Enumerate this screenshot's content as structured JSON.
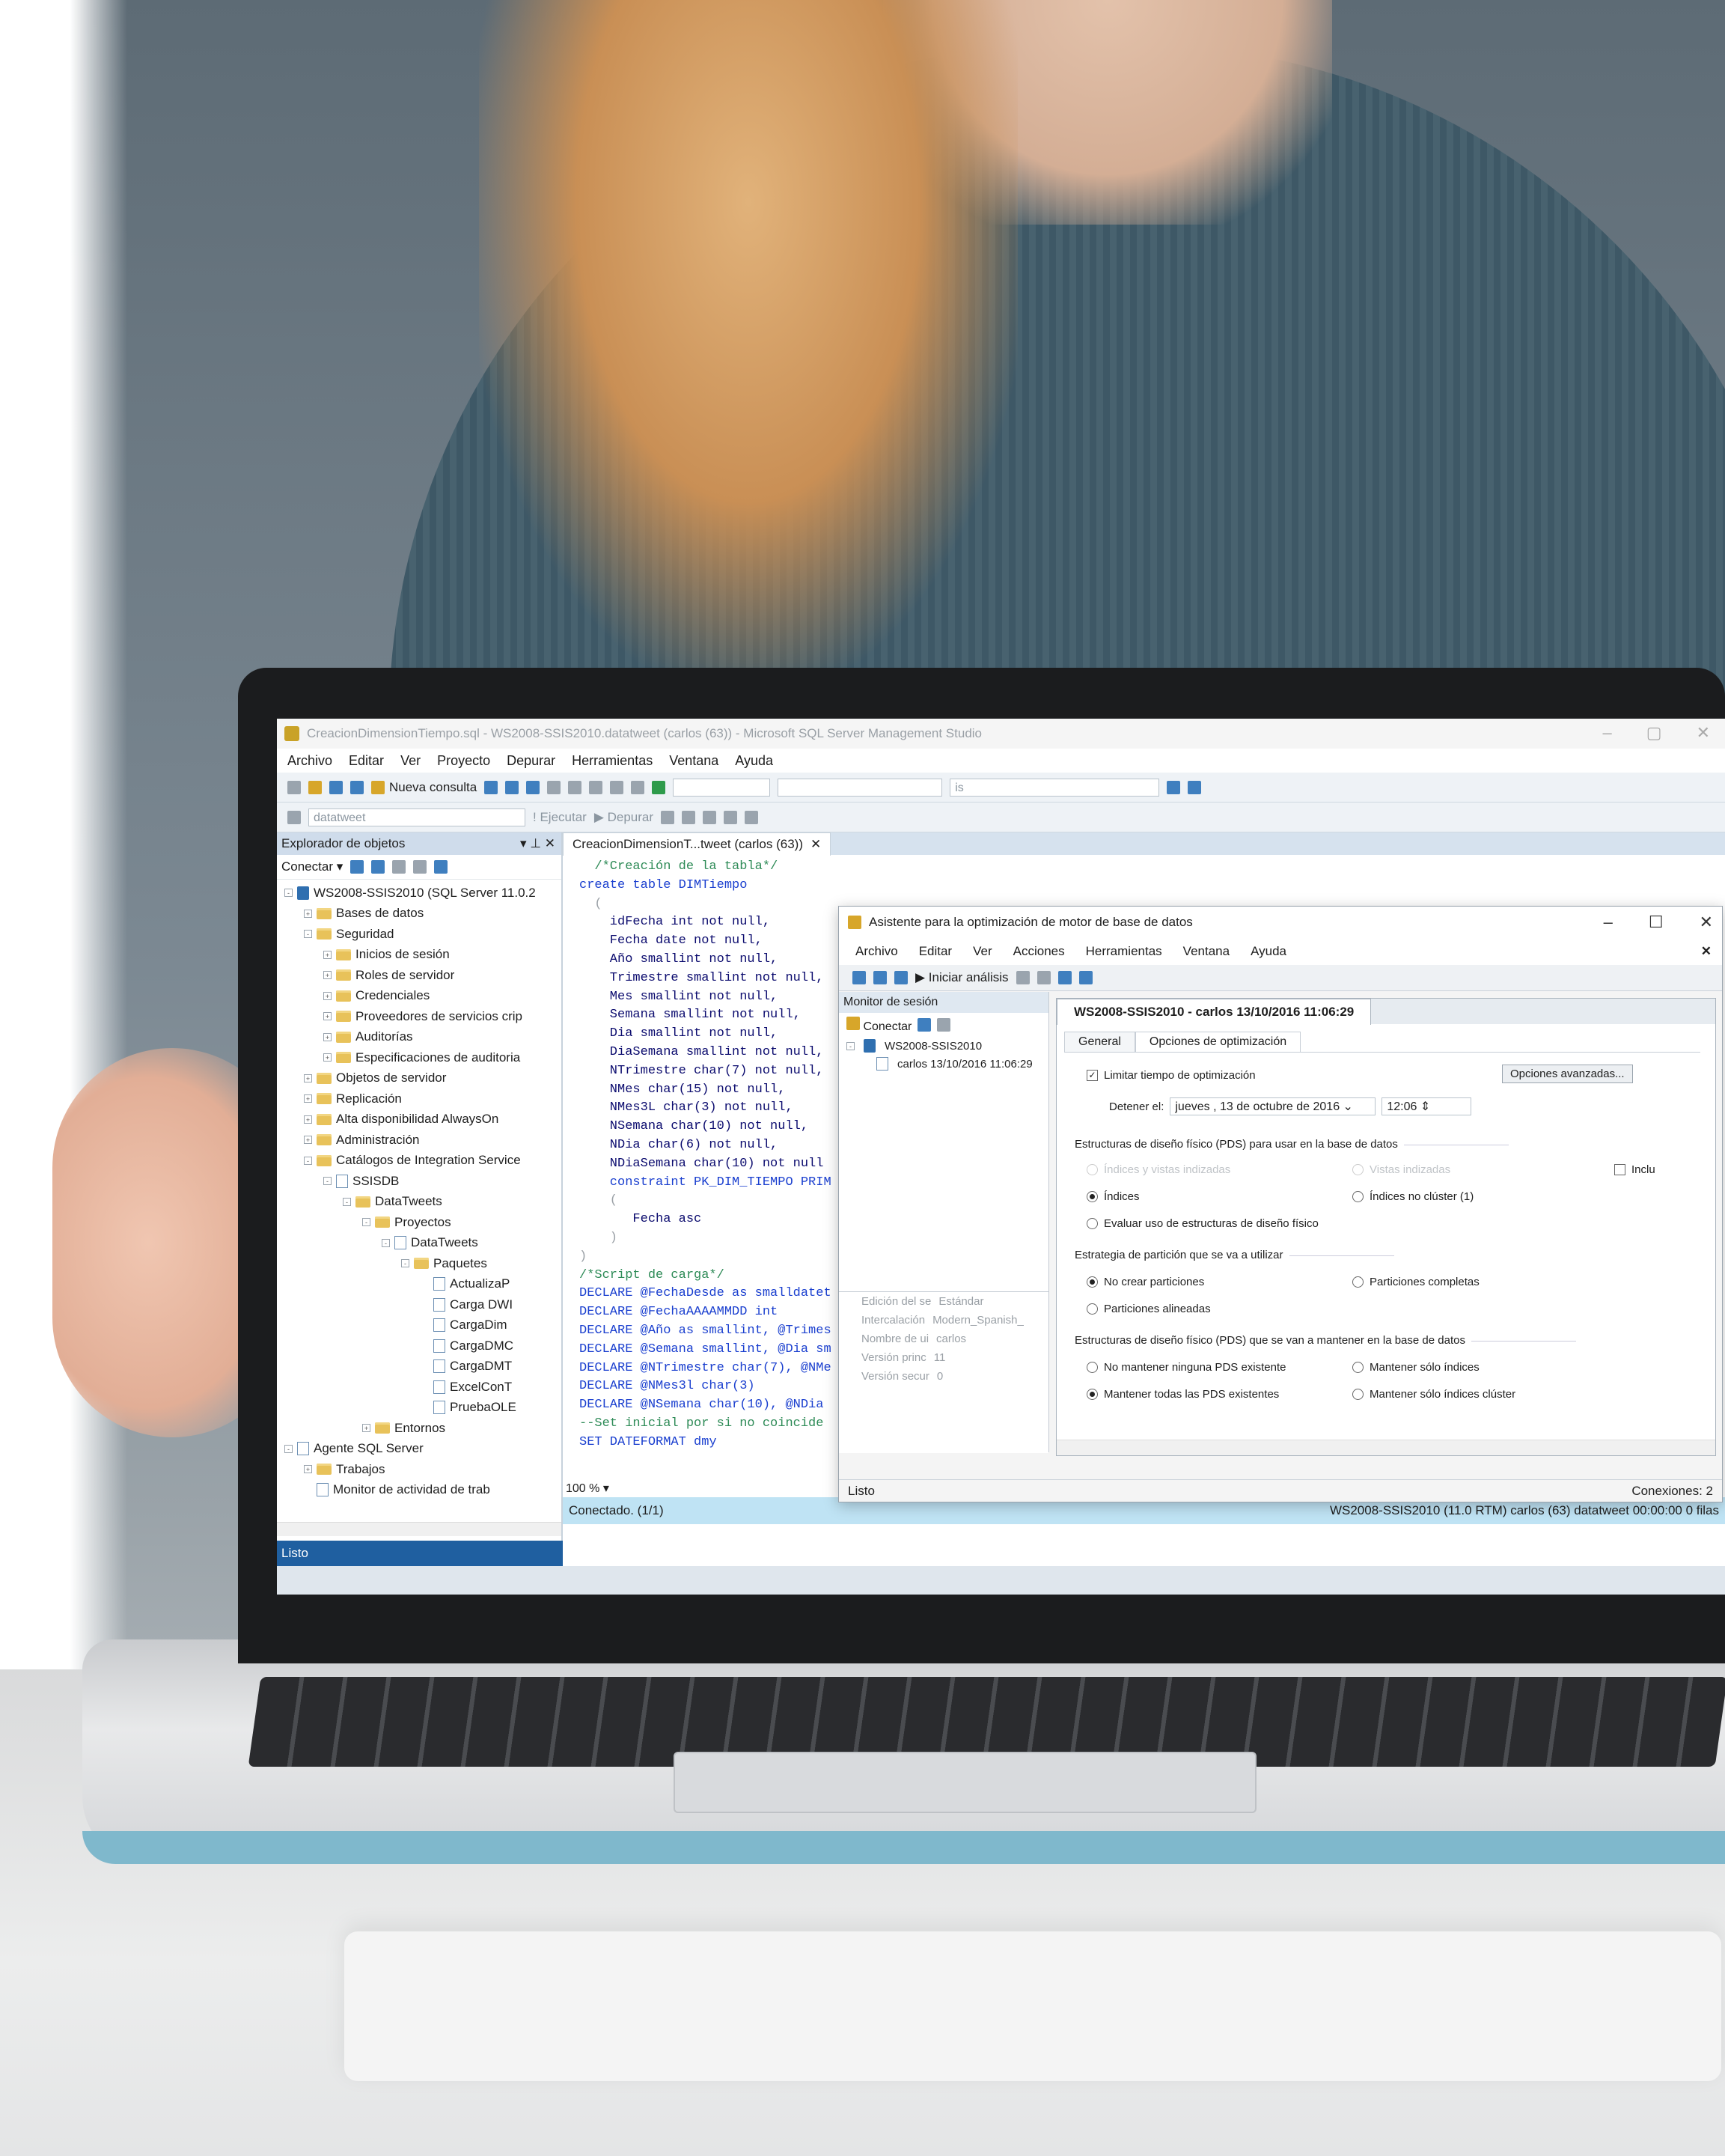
{
  "ssms": {
    "window_title": "CreacionDimensionTiempo.sql - WS2008-SSIS2010.datatweet (carlos (63)) - Microsoft SQL Server Management Studio",
    "menu": [
      "Archivo",
      "Editar",
      "Ver",
      "Proyecto",
      "Depurar",
      "Herramientas",
      "Ventana",
      "Ayuda"
    ],
    "toolbar": {
      "new_query": "Nueva consulta",
      "search_value": "is",
      "database": "datatweet",
      "execute": "Ejecutar",
      "debug": "Depurar"
    },
    "object_explorer": {
      "title": "Explorador de objetos",
      "connect": "Conectar",
      "nodes": [
        {
          "label": "WS2008-SSIS2010 (SQL Server 11.0.2",
          "level": 0,
          "kind": "server",
          "expand": "-"
        },
        {
          "label": "Bases de datos",
          "level": 1,
          "kind": "folder",
          "expand": "+"
        },
        {
          "label": "Seguridad",
          "level": 1,
          "kind": "folder",
          "expand": "-"
        },
        {
          "label": "Inicios de sesión",
          "level": 2,
          "kind": "folder",
          "expand": "+"
        },
        {
          "label": "Roles de servidor",
          "level": 2,
          "kind": "folder",
          "expand": "+"
        },
        {
          "label": "Credenciales",
          "level": 2,
          "kind": "folder",
          "expand": "+"
        },
        {
          "label": "Proveedores de servicios crip",
          "level": 2,
          "kind": "folder",
          "expand": "+"
        },
        {
          "label": "Auditorías",
          "level": 2,
          "kind": "folder",
          "expand": "+"
        },
        {
          "label": "Especificaciones de auditoria",
          "level": 2,
          "kind": "folder",
          "expand": "+"
        },
        {
          "label": "Objetos de servidor",
          "level": 1,
          "kind": "folder",
          "expand": "+"
        },
        {
          "label": "Replicación",
          "level": 1,
          "kind": "folder",
          "expand": "+"
        },
        {
          "label": "Alta disponibilidad AlwaysOn",
          "level": 1,
          "kind": "folder",
          "expand": "+"
        },
        {
          "label": "Administración",
          "level": 1,
          "kind": "folder",
          "expand": "+"
        },
        {
          "label": "Catálogos de Integration Service",
          "level": 1,
          "kind": "folder",
          "expand": "-"
        },
        {
          "label": "SSISDB",
          "level": 2,
          "kind": "pkg",
          "expand": "-"
        },
        {
          "label": "DataTweets",
          "level": 3,
          "kind": "folder",
          "expand": "-"
        },
        {
          "label": "Proyectos",
          "level": 4,
          "kind": "folder",
          "expand": "-"
        },
        {
          "label": "DataTweets",
          "level": 5,
          "kind": "pkg",
          "expand": "-"
        },
        {
          "label": "Paquetes",
          "level": 6,
          "kind": "folder",
          "expand": "-"
        },
        {
          "label": "ActualizaP",
          "level": 7,
          "kind": "pkg",
          "expand": ""
        },
        {
          "label": "Carga DWI",
          "level": 7,
          "kind": "pkg",
          "expand": ""
        },
        {
          "label": "CargaDim",
          "level": 7,
          "kind": "pkg",
          "expand": ""
        },
        {
          "label": "CargaDMC",
          "level": 7,
          "kind": "pkg",
          "expand": ""
        },
        {
          "label": "CargaDMT",
          "level": 7,
          "kind": "pkg",
          "expand": ""
        },
        {
          "label": "ExcelConT",
          "level": 7,
          "kind": "pkg",
          "expand": ""
        },
        {
          "label": "PruebaOLE",
          "level": 7,
          "kind": "pkg",
          "expand": ""
        },
        {
          "label": "Entornos",
          "level": 4,
          "kind": "folder",
          "expand": "+"
        },
        {
          "label": "Agente SQL Server",
          "level": 0,
          "kind": "pkg",
          "expand": "-"
        },
        {
          "label": "Trabajos",
          "level": 1,
          "kind": "folder",
          "expand": "+"
        },
        {
          "label": "Monitor de actividad de trab",
          "level": 1,
          "kind": "pkg",
          "expand": ""
        }
      ],
      "status": "Listo"
    },
    "editor": {
      "tab_label": "CreacionDimensionT...tweet (carlos (63))",
      "zoom": "100 %",
      "code_lines": [
        [
          "cm",
          "  /*Creación de la tabla*/"
        ],
        [
          "kw",
          "create table DIMTiempo"
        ],
        [
          "gr",
          "  ("
        ],
        [
          "id",
          "    idFecha int not null,"
        ],
        [
          "id",
          "    Fecha date not null,"
        ],
        [
          "id",
          "    Año smallint not null,"
        ],
        [
          "id",
          "    Trimestre smallint not null,"
        ],
        [
          "id",
          "    Mes smallint not null,"
        ],
        [
          "id",
          "    Semana smallint not null,"
        ],
        [
          "id",
          "    Dia smallint not null,"
        ],
        [
          "id",
          "    DiaSemana smallint not null,"
        ],
        [
          "id",
          "    NTrimestre char(7) not null,"
        ],
        [
          "id",
          "    NMes char(15) not null,"
        ],
        [
          "id",
          "    NMes3L char(3) not null,"
        ],
        [
          "id",
          "    NSemana char(10) not null,"
        ],
        [
          "id",
          "    NDia char(6) not null,"
        ],
        [
          "id",
          "    NDiaSemana char(10) not null"
        ],
        [
          "kw",
          "    constraint PK_DIM_TIEMPO PRIM"
        ],
        [
          "gr",
          "    ("
        ],
        [
          "id",
          "       Fecha asc"
        ],
        [
          "gr",
          "    )"
        ],
        [
          "gr",
          ")"
        ],
        [
          "gr",
          ""
        ],
        [
          "cm",
          "/*Script de carga*/"
        ],
        [
          "kw",
          "DECLARE @FechaDesde as smalldatet"
        ],
        [
          "kw",
          "DECLARE @FechaAAAAMMDD int"
        ],
        [
          "kw",
          "DECLARE @Año as smallint, @Trimes"
        ],
        [
          "kw",
          "DECLARE @Semana smallint, @Dia sm"
        ],
        [
          "kw",
          "DECLARE @NTrimestre char(7), @NMe"
        ],
        [
          "kw",
          "DECLARE @NMes3l char(3)"
        ],
        [
          "kw",
          "DECLARE @NSemana char(10), @NDia"
        ],
        [
          "cm",
          "--Set inicial por si no coincide"
        ],
        [
          "kw",
          "SET DATEFORMAT dmy"
        ]
      ],
      "status_left": "Conectado. (1/1)",
      "status_right": "WS2008-SSIS2010 (11.0 RTM)   carlos (63)   datatweet   00:00:00   0 filas"
    }
  },
  "tuning_advisor": {
    "title": "Asistente para la optimización de motor de base de datos",
    "menu": [
      "Archivo",
      "Editar",
      "Ver",
      "Acciones",
      "Herramientas",
      "Ventana",
      "Ayuda"
    ],
    "start_analysis": "Iniciar análisis",
    "session_monitor": "Monitor de sesión",
    "connect": "Conectar",
    "server": "WS2008-SSIS2010",
    "session_item": "carlos 13/10/2016 11:06:29",
    "properties": [
      [
        "Edición del se",
        "Estándar"
      ],
      [
        "Intercalación",
        "Modern_Spanish_"
      ],
      [
        "Nombre de ui",
        "carlos"
      ],
      [
        "Versión princ",
        "11"
      ],
      [
        "Versión secur",
        "0"
      ]
    ],
    "session_tab": "WS2008-SSIS2010 - carlos 13/10/2016 11:06:29",
    "subtabs": [
      "General",
      "Opciones de optimización"
    ],
    "limit_time": "Limitar tiempo de optimización",
    "advanced_options": "Opciones avanzadas...",
    "stop_at": "Detener el:",
    "stop_date": "jueves , 13 de  octubre  de 2016",
    "stop_time": "12:06",
    "pds_use_title": "Estructuras de diseño físico (PDS) para usar en la base de datos",
    "opt_indexes_views": "Índices y vistas indizadas",
    "opt_indexed_views": "Vistas indizadas",
    "opt_include": "Inclu",
    "opt_indexes": "Índices",
    "opt_nonclustered": "Índices no clúster (1)",
    "opt_evaluate": "Evaluar uso de estructuras de diseño físico",
    "partition_title": "Estrategia de partición que se va a utilizar",
    "opt_no_partitions": "No crear particiones",
    "opt_full_partitions": "Particiones completas",
    "opt_aligned": "Particiones alineadas",
    "pds_keep_title": "Estructuras de diseño físico (PDS) que se van a mantener en la base de datos",
    "opt_keep_none": "No mantener ninguna PDS existente",
    "opt_keep_indexes": "Mantener sólo índices",
    "opt_keep_all": "Mantener todas las PDS existentes",
    "opt_keep_clustered": "Mantener sólo índices clúster",
    "status_left": "Listo",
    "status_right": "Conexiones: 2"
  }
}
